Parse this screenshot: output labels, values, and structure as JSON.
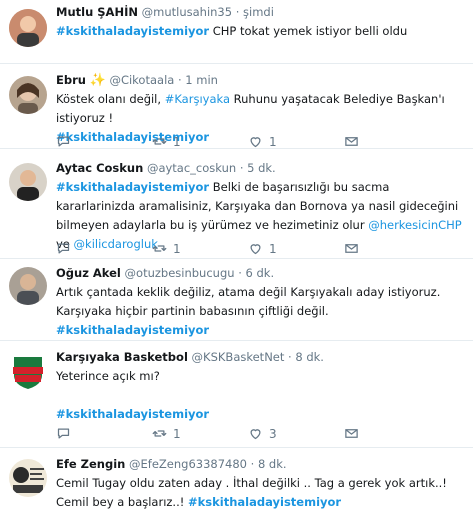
{
  "colors": {
    "link": "#1b95e0",
    "muted": "#657786",
    "divider": "#e6ecf0",
    "text": "#14171a"
  },
  "icons": [
    "reply-icon",
    "retweet-icon",
    "like-icon",
    "direct-message-icon"
  ],
  "tweets": [
    {
      "name": "Mutlu ŞAHİN",
      "handle": "@mutlusahin35",
      "sep": "·",
      "time": "şimdi",
      "hashtag": "#kskithaladayistemiyor",
      "text": " CHP tokat yemek istiyor belli oldu"
    },
    {
      "name": "Ebru",
      "emoji": "✨",
      "handle": "@Cikotaala",
      "sep": "·",
      "time": "1 min",
      "text_a": "Köstek olanı değil,  ",
      "hashtag_inline": "#Karşıyaka",
      "text_b": " Ruhunu yaşatacak Belediye Başkan'ı  istiyoruz !",
      "hashtag": "#kskithaladayistemiyor",
      "reply_count": "",
      "retweet_count": "1",
      "like_count": "1"
    },
    {
      "name": "Aytac Coskun",
      "handle": "@aytac_coskun",
      "sep": "·",
      "time": "5 dk.",
      "hashtag": "#kskithaladayistemiyor",
      "text_a": " Belki de başarısızlığı bu sacma kararlarinizda aramalisiniz, Karşıyaka dan Bornova ya nasil gideceğini bilmeyen adaylarla bu iş yürümez ve hezimetiniz olur ",
      "mention1": "@herkesicinCHP",
      "text_b": " ve ",
      "mention2": "@kilicdarogluk",
      "reply_count": "",
      "retweet_count": "1",
      "like_count": "1"
    },
    {
      "name": "Oğuz Akel",
      "handle": "@otuzbesinbucugu",
      "sep": "·",
      "time": "6 dk.",
      "text": "Artık çantada keklik değiliz, atama değil Karşıyakalı aday istiyoruz. Karşıyaka hiçbir partinin babasının çiftliği değil. ",
      "hashtag": "#kskithaladayistemiyor"
    },
    {
      "name": "Karşıyaka Basketbol",
      "handle": "@KSKBasketNet",
      "sep": "·",
      "time": "8 dk.",
      "text": "Yeterince açık mı?",
      "hashtag": "#kskithaladayistemiyor",
      "logo_top": "KARŞIYAKA",
      "logo_bottom": "BASKETBOL",
      "reply_count": "",
      "retweet_count": "1",
      "like_count": "3"
    },
    {
      "name": "Efe Zengin",
      "handle": "@EfeZeng63387480",
      "sep": "·",
      "time": "8 dk.",
      "text": "Cemil Tugay oldu zaten aday . İthal değilki .. Tag a gerek yok artık..! Cemil bey a başlarız..! ",
      "hashtag": "#kskithaladayistemiyor"
    }
  ]
}
